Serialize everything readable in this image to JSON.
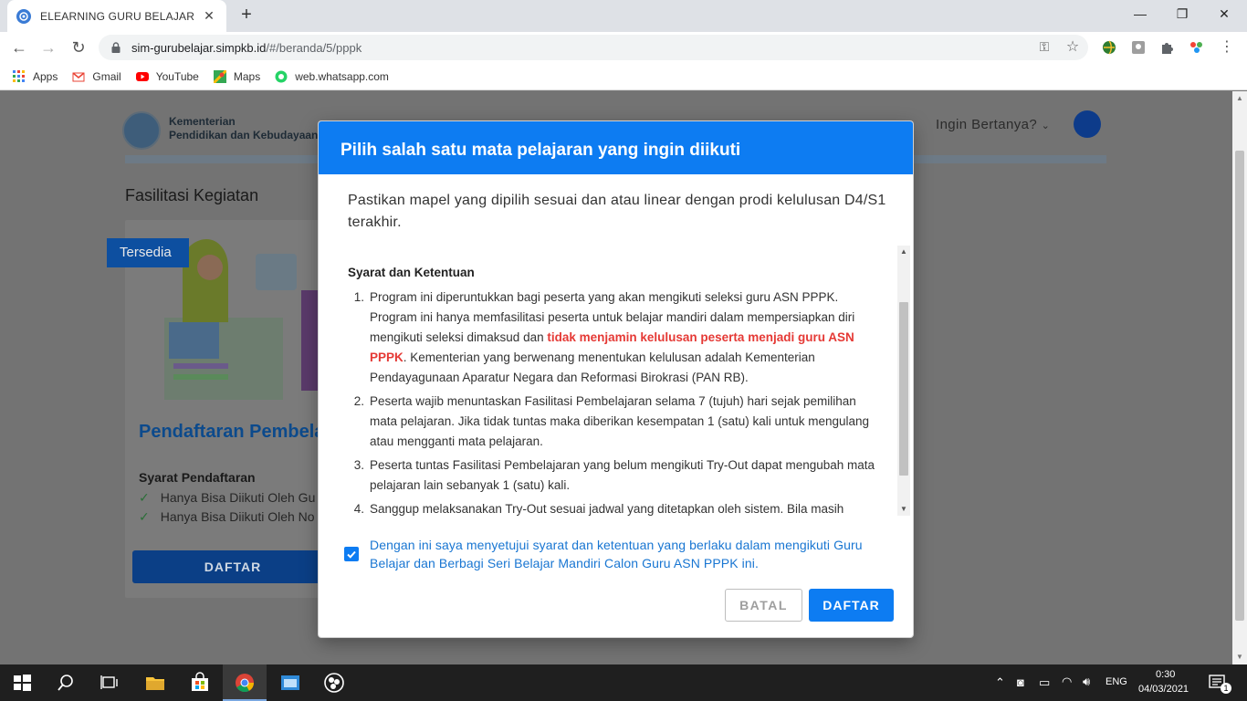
{
  "browser": {
    "tab_title": "ELEARNING GURU BELAJAR",
    "url_host": "sim-gurubelajar.simpkb.id",
    "url_path": "/#/beranda/5/pppk",
    "bookmarks": [
      "Apps",
      "Gmail",
      "YouTube",
      "Maps",
      "web.whatsapp.com"
    ]
  },
  "site": {
    "name_line1": "Kementerian",
    "name_line2": "Pendidikan dan Kebudayaan",
    "nav_partial": "Ingin Bertanya?"
  },
  "page": {
    "section_title": "Fasilitasi Kegiatan",
    "ribbon": "Tersedia",
    "card_title": "Pendaftaran Pembela",
    "card_subtitle": "Syarat Pendaftaran",
    "card_items": [
      "Hanya Bisa Diikuti Oleh Gu",
      "Hanya Bisa Diikuti Oleh No"
    ],
    "card_button": "DAFTAR"
  },
  "modal": {
    "title": "Pilih salah satu mata pelajaran yang ingin diikuti",
    "intro": "Pastikan mapel yang dipilih sesuai dan atau linear dengan prodi kelulusan D4/S1 terakhir.",
    "terms_title": "Syarat dan Ketentuan",
    "terms": [
      {
        "num": "1.",
        "text_before": "Program ini diperuntukkan bagi peserta yang akan mengikuti seleksi guru ASN PPPK. Program ini hanya memfasilitasi peserta untuk belajar mandiri dalam mempersiapkan diri mengikuti seleksi dimaksud dan ",
        "text_red": "tidak menjamin kelulusan peserta menjadi guru ASN PPPK",
        "text_after": ". Kementerian yang berwenang menentukan kelulusan adalah Kementerian Pendayagunaan Aparatur Negara dan Reformasi Birokrasi (PAN RB)."
      },
      {
        "num": "2.",
        "text": "Peserta wajib menuntaskan Fasilitasi Pembelajaran selama 7 (tujuh) hari sejak pemilihan mata pelajaran. Jika tidak tuntas maka diberikan kesempatan 1 (satu) kali untuk mengulang atau mengganti mata pelajaran."
      },
      {
        "num": "3.",
        "text": "Peserta tuntas Fasilitasi Pembelajaran yang belum mengikuti Try-Out dapat mengubah mata pelajaran lain sebanyak 1 (satu) kali."
      },
      {
        "num": "4.",
        "text": "Sanggup melaksanakan Try-Out sesuai jadwal yang ditetapkan oleh sistem. Bila masih"
      }
    ],
    "agree_text": "Dengan ini saya menyetujui syarat dan ketentuan yang berlaku dalam mengikuti Guru Belajar dan Berbagi Seri Belajar Mandiri Calon Guru ASN PPPK ini.",
    "agree_checked": true,
    "cancel_label": "BATAL",
    "submit_label": "DAFTAR"
  },
  "taskbar": {
    "language": "ENG",
    "time": "0:30",
    "date": "04/03/2021",
    "notification_count": "1"
  },
  "colors": {
    "primary": "#0d7cf2",
    "warning_red": "#e53935",
    "link_blue": "#1976d2"
  }
}
